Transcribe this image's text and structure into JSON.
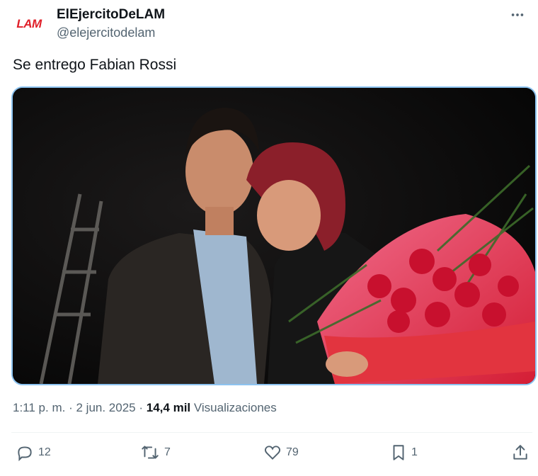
{
  "account": {
    "avatar_text": "LAM",
    "display_name": "ElEjercitoDeLAM",
    "handle": "@elejercitodelam"
  },
  "tweet": {
    "text": "Se entrego Fabian Rossi",
    "time": "1:11 p. m.",
    "separator": "·",
    "date": "2 jun. 2025",
    "views_count": "14,4 mil",
    "views_label": "Visualizaciones"
  },
  "actions": {
    "replies": "12",
    "reposts": "7",
    "likes": "79",
    "bookmarks": "1"
  },
  "icons": {
    "more": "more-horizontal-icon",
    "reply": "reply-icon",
    "repost": "repost-icon",
    "like": "heart-icon",
    "bookmark": "bookmark-icon",
    "share": "share-icon"
  },
  "colors": {
    "text": "#0f1419",
    "secondary": "#536471",
    "brand_red": "#e0202a",
    "media_border": "#8cc3f0"
  }
}
